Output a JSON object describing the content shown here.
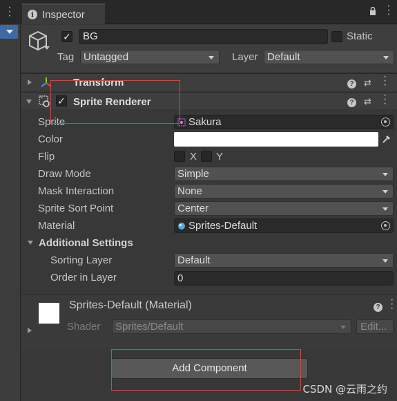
{
  "tab": {
    "label": "Inspector"
  },
  "header": {
    "active": true,
    "name": "BG",
    "static_label": "Static",
    "tag_label": "Tag",
    "tag_value": "Untagged",
    "layer_label": "Layer",
    "layer_value": "Default"
  },
  "transform": {
    "title": "Transform"
  },
  "sprite_renderer": {
    "title": "Sprite Renderer",
    "enabled": true,
    "sprite_label": "Sprite",
    "sprite_value": "Sakura",
    "color_label": "Color",
    "color_value": "#ffffff",
    "flip_label": "Flip",
    "flip_x_label": "X",
    "flip_y_label": "Y",
    "draw_mode_label": "Draw Mode",
    "draw_mode_value": "Simple",
    "mask_label": "Mask Interaction",
    "mask_value": "None",
    "sort_point_label": "Sprite Sort Point",
    "sort_point_value": "Center",
    "material_label": "Material",
    "material_value": "Sprites-Default",
    "additional_label": "Additional Settings",
    "sorting_layer_label": "Sorting Layer",
    "sorting_layer_value": "Default",
    "order_label": "Order in Layer",
    "order_value": "0"
  },
  "material": {
    "title": "Sprites-Default (Material)",
    "shader_label": "Shader",
    "shader_value": "Sprites/Default",
    "edit_label": "Edit..."
  },
  "add_component_label": "Add Component",
  "watermark": "CSDN @云雨之约",
  "colors": {
    "annotation_red": "#c94848",
    "accent_blue": "#3d6aa6"
  }
}
